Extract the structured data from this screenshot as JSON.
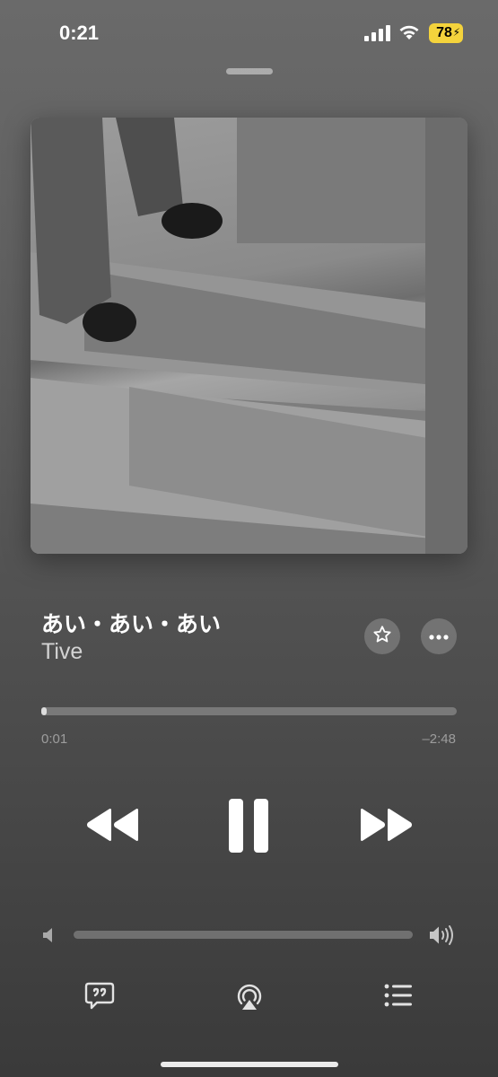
{
  "status_bar": {
    "time": "0:21",
    "battery": "78",
    "icons": [
      "cellular-signal-icon",
      "wifi-icon",
      "battery-charging-icon"
    ]
  },
  "now_playing": {
    "title": "あい・あい・あい",
    "artist": "Tive",
    "progress_fraction": 0.005,
    "elapsed": "0:01",
    "remaining": "–2:48",
    "volume_fraction": 0.0
  },
  "controls": {
    "icons": [
      "star-icon",
      "more-icon",
      "rewind-icon",
      "pause-icon",
      "fast-forward-icon",
      "volume-low-icon",
      "volume-high-icon",
      "lyrics-icon",
      "airplay-icon",
      "queue-icon"
    ]
  },
  "colors": {
    "battery": "#f4d33c",
    "background_top": "#6a6a6a",
    "background_bottom": "#3a3a3a"
  }
}
